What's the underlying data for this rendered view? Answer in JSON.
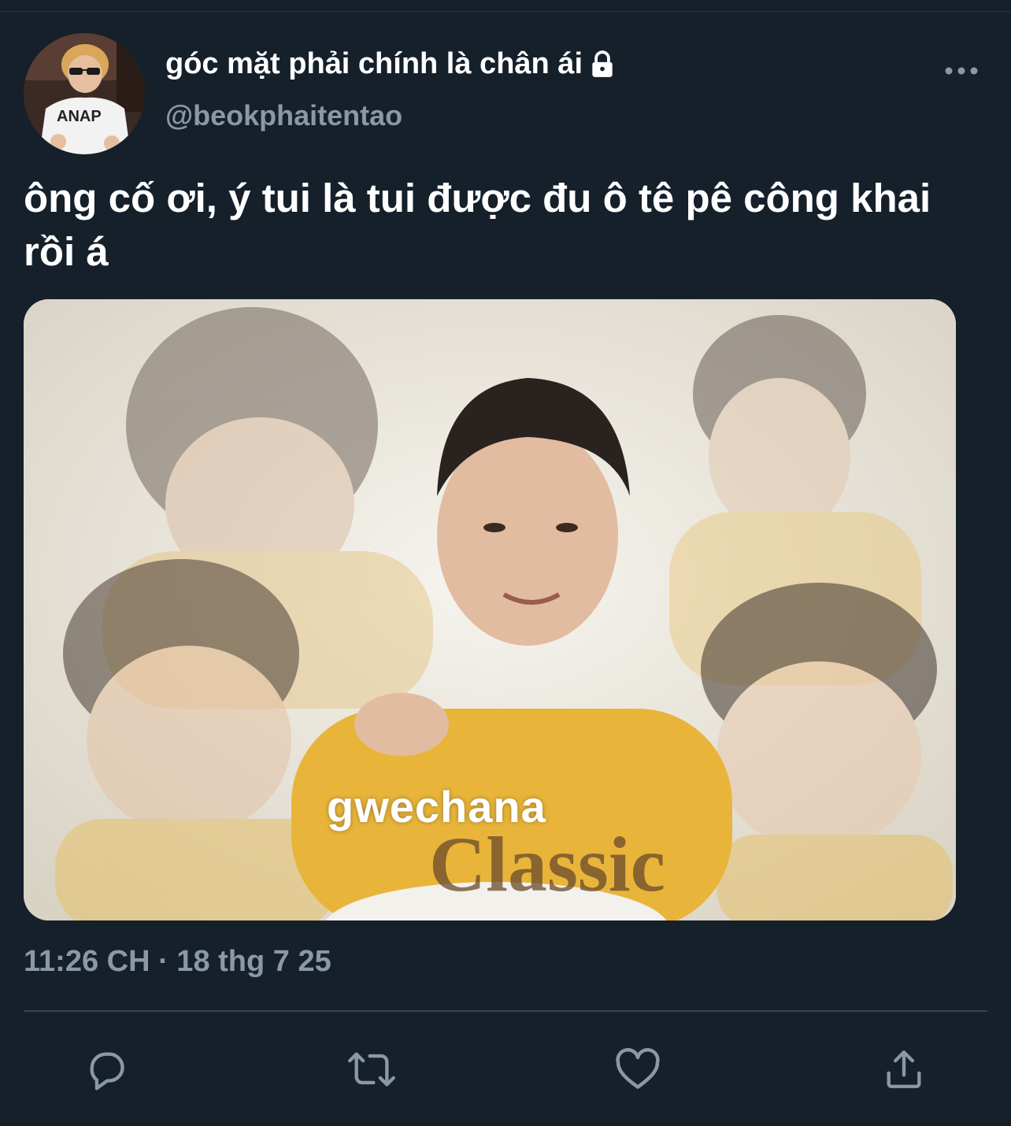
{
  "tweet": {
    "display_name": "góc mặt phải chính là chân ái",
    "handle": "@beokphaitentao",
    "text": "ông cố ơi, ý tui là tui được đu ô tê pê công khai rồi á",
    "timestamp": "11:26 CH · 18 thg 7 25",
    "avatar_shirt_text": "ANAP",
    "media": {
      "caption": "gwechana",
      "shirt_text": "Classic"
    }
  },
  "icons": {
    "lock": "lock-icon",
    "more": "more-horizontal-icon",
    "reply": "reply-icon",
    "retweet": "retweet-icon",
    "like": "heart-icon",
    "share": "share-icon"
  },
  "colors": {
    "background": "#15202b",
    "text_primary": "#ffffff",
    "text_secondary": "#8b98a5",
    "divider": "#38444d"
  }
}
